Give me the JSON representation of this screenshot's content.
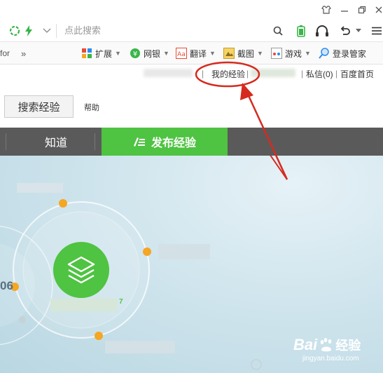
{
  "address": {
    "placeholder": "点此搜索"
  },
  "toolbar": {
    "overflow_left": "for",
    "chevrons": "»",
    "items": [
      "扩展",
      "网银",
      "翻译",
      "截图",
      "游戏",
      "登录管家"
    ]
  },
  "toplinks": {
    "my_experience": "我的经验",
    "messages": "私信(0)",
    "baidu_home": "百度首页",
    "sep": "|"
  },
  "search": {
    "button": "搜索经验",
    "help": "帮助"
  },
  "nav": {
    "zhidao": "知道",
    "publish": "发布经验"
  },
  "hero": {
    "partial_number": "06",
    "partial_green": "7"
  },
  "watermark": {
    "brand": "Bai",
    "brand2": "经验",
    "url": "jingyan.baidu.com"
  },
  "colors": {
    "green": "#4fc342",
    "annotation_red": "#d52b1e",
    "node_orange": "#f5a623",
    "nav_bg": "#5a5a5a"
  }
}
